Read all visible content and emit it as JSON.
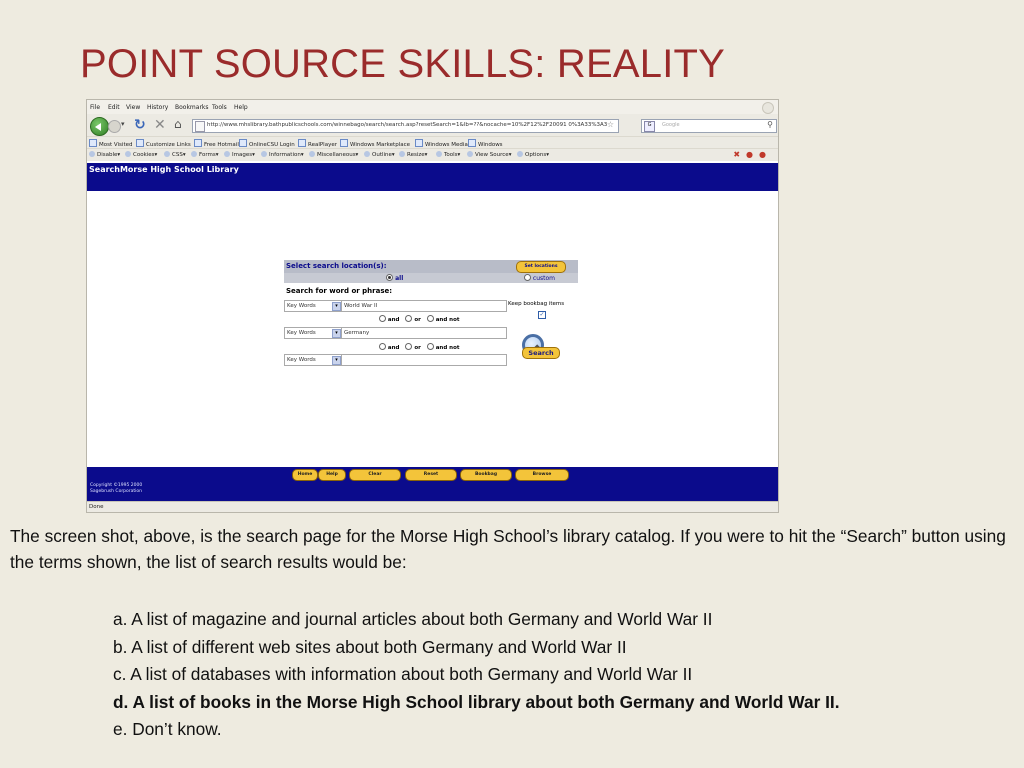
{
  "slide": {
    "title": "POINT SOURCE SKILLS:  REALITY",
    "intro": "The screen shot, above, is the search page for the Morse High School’s library catalog.  If you were to hit the “Search”  button using the terms shown, the list of search results would be:",
    "options": [
      "a.  A list of magazine and journal articles about both Germany and World War II",
      "b. A list of different web sites about both Germany and World War II",
      "c. A list of databases with information about both Germany and World War II",
      "d.  A list of books in the Morse High School library about both Germany and World War II.",
      "e.  Don’t know."
    ],
    "highlighted_option_index": 3
  },
  "browser": {
    "menu": [
      "File",
      "Edit",
      "View",
      "History",
      "Bookmarks",
      "Tools",
      "Help"
    ],
    "url": "http://www.mhslibrary.bathpublicschools.com/winnebago/search/search.asp?resetSearch=1&lb=??&nocache=10%2F12%2F20091 0%3A33%3A37",
    "search_placeholder": "Google",
    "bookmarks": [
      "Most Visited",
      "Customize Links",
      "Free Hotmail",
      "OnlineCSU Login",
      "RealPlayer",
      "Windows Marketplace",
      "Windows Media",
      "Windows"
    ],
    "dev_toolbar": [
      "Disable▾",
      "Cookies▾",
      "CSS▾",
      "Forms▾",
      "Images▾",
      "Information▾",
      "Miscellaneous▾",
      "Outline▾",
      "Resize▾",
      "Tools▾",
      "View Source▾",
      "Options▾"
    ],
    "status": "Done"
  },
  "library_page": {
    "header_prefix": "Search",
    "header_title": "Morse High School Library",
    "location_label": "Select search location(s):",
    "set_locations_button": "Set locations",
    "radio_all": "all",
    "radio_custom": "custom",
    "word_label": "Search for word or phrase:",
    "rows": [
      {
        "field": "Key Words",
        "value": "World War II"
      },
      {
        "field": "Key Words",
        "value": "Germany"
      },
      {
        "field": "Key Words",
        "value": ""
      }
    ],
    "bool": {
      "and": "and",
      "or": "or",
      "and_not": "and not"
    },
    "keep_bookbag": "Keep bookbag items",
    "search_button": "Search",
    "footer_buttons": [
      "Home",
      "Help",
      "Clear",
      "Reset",
      "Bookbag",
      "Browse"
    ],
    "copyright_line1": "Copyright ©1995 2000",
    "copyright_line2": "Sagebrush Corporation"
  }
}
